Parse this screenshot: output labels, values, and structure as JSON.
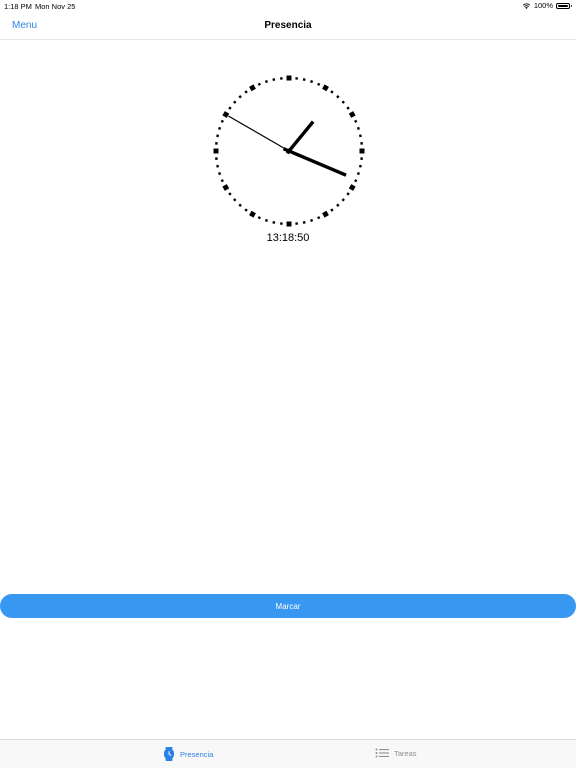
{
  "status_bar": {
    "time": "1:18 PM",
    "date": "Mon Nov 25",
    "battery": "100%",
    "wifi_icon": "wifi-icon",
    "battery_icon": "battery-icon"
  },
  "nav": {
    "menu_label": "Menu",
    "title": "Presencia"
  },
  "clock": {
    "time": "13:18:50",
    "hours": 13,
    "minutes": 18,
    "seconds": 50
  },
  "action": {
    "marcar_label": "Marcar"
  },
  "tabs": [
    {
      "label": "Presencia",
      "icon": "watch-icon",
      "selected": true
    },
    {
      "label": "Tareas",
      "icon": "list-icon",
      "selected": false
    }
  ],
  "colors": {
    "accent": "#2a82e4",
    "button": "#3897f0",
    "inactive": "#8e8e93"
  }
}
